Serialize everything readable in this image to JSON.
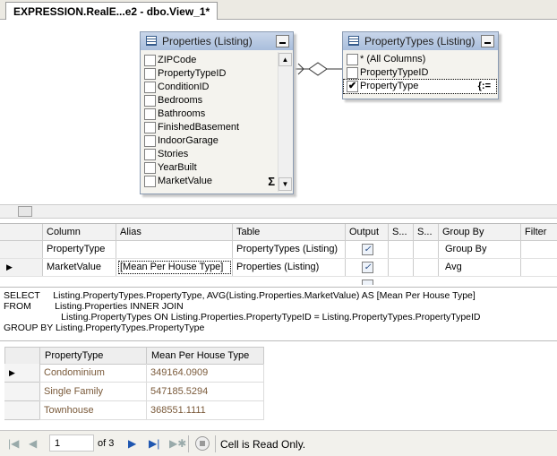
{
  "tab": {
    "title": "EXPRESSION.RealE...e2 - dbo.View_1*"
  },
  "tables": {
    "properties": {
      "title": "Properties (Listing)",
      "fields": [
        {
          "label": "ZIPCode",
          "checked": false
        },
        {
          "label": "PropertyTypeID",
          "checked": false
        },
        {
          "label": "ConditionID",
          "checked": false
        },
        {
          "label": "Bedrooms",
          "checked": false
        },
        {
          "label": "Bathrooms",
          "checked": false
        },
        {
          "label": "FinishedBasement",
          "checked": false
        },
        {
          "label": "IndoorGarage",
          "checked": false
        },
        {
          "label": "Stories",
          "checked": false
        },
        {
          "label": "YearBuilt",
          "checked": false
        },
        {
          "label": "MarketValue",
          "checked": false,
          "aggregate": "Σ"
        }
      ]
    },
    "propertytypes": {
      "title": "PropertyTypes (Listing)",
      "fields": [
        {
          "label": "* (All Columns)",
          "checked": false
        },
        {
          "label": "PropertyTypeID",
          "checked": false
        },
        {
          "label": "PropertyType",
          "checked": true,
          "group_icon": "{:="
        }
      ]
    }
  },
  "grid": {
    "headers": [
      "Column",
      "Alias",
      "Table",
      "Output",
      "S...",
      "S...",
      "Group By",
      "Filter"
    ],
    "rows": [
      {
        "column": "PropertyType",
        "alias": "",
        "table": "PropertyTypes (Listing)",
        "output": true,
        "group_by": "Group By"
      },
      {
        "column": "MarketValue",
        "alias": "[Mean Per House Type]",
        "table": "Properties (Listing)",
        "output": true,
        "group_by": "Avg"
      }
    ]
  },
  "sql": {
    "line1": "SELECT     Listing.PropertyTypes.PropertyType, AVG(Listing.Properties.MarketValue) AS [Mean Per House Type]",
    "line2": "FROM         Listing.Properties INNER JOIN",
    "line3": "                      Listing.PropertyTypes ON Listing.Properties.PropertyTypeID = Listing.PropertyTypes.PropertyTypeID",
    "line4": "GROUP BY Listing.PropertyTypes.PropertyType"
  },
  "results": {
    "headers": [
      "PropertyType",
      "Mean Per House Type"
    ],
    "rows": [
      {
        "type": "Condominium",
        "mean": "349164.0909"
      },
      {
        "type": "Single Family",
        "mean": "547185.5294"
      },
      {
        "type": "Townhouse",
        "mean": "368551.1111"
      }
    ]
  },
  "nav": {
    "page": "1",
    "of_label": "of 3",
    "status": "Cell is Read Only."
  },
  "colors": {
    "accent": "#1e56b0",
    "header_grad": "#a9bedc",
    "result_text": "#7a5a3a"
  }
}
